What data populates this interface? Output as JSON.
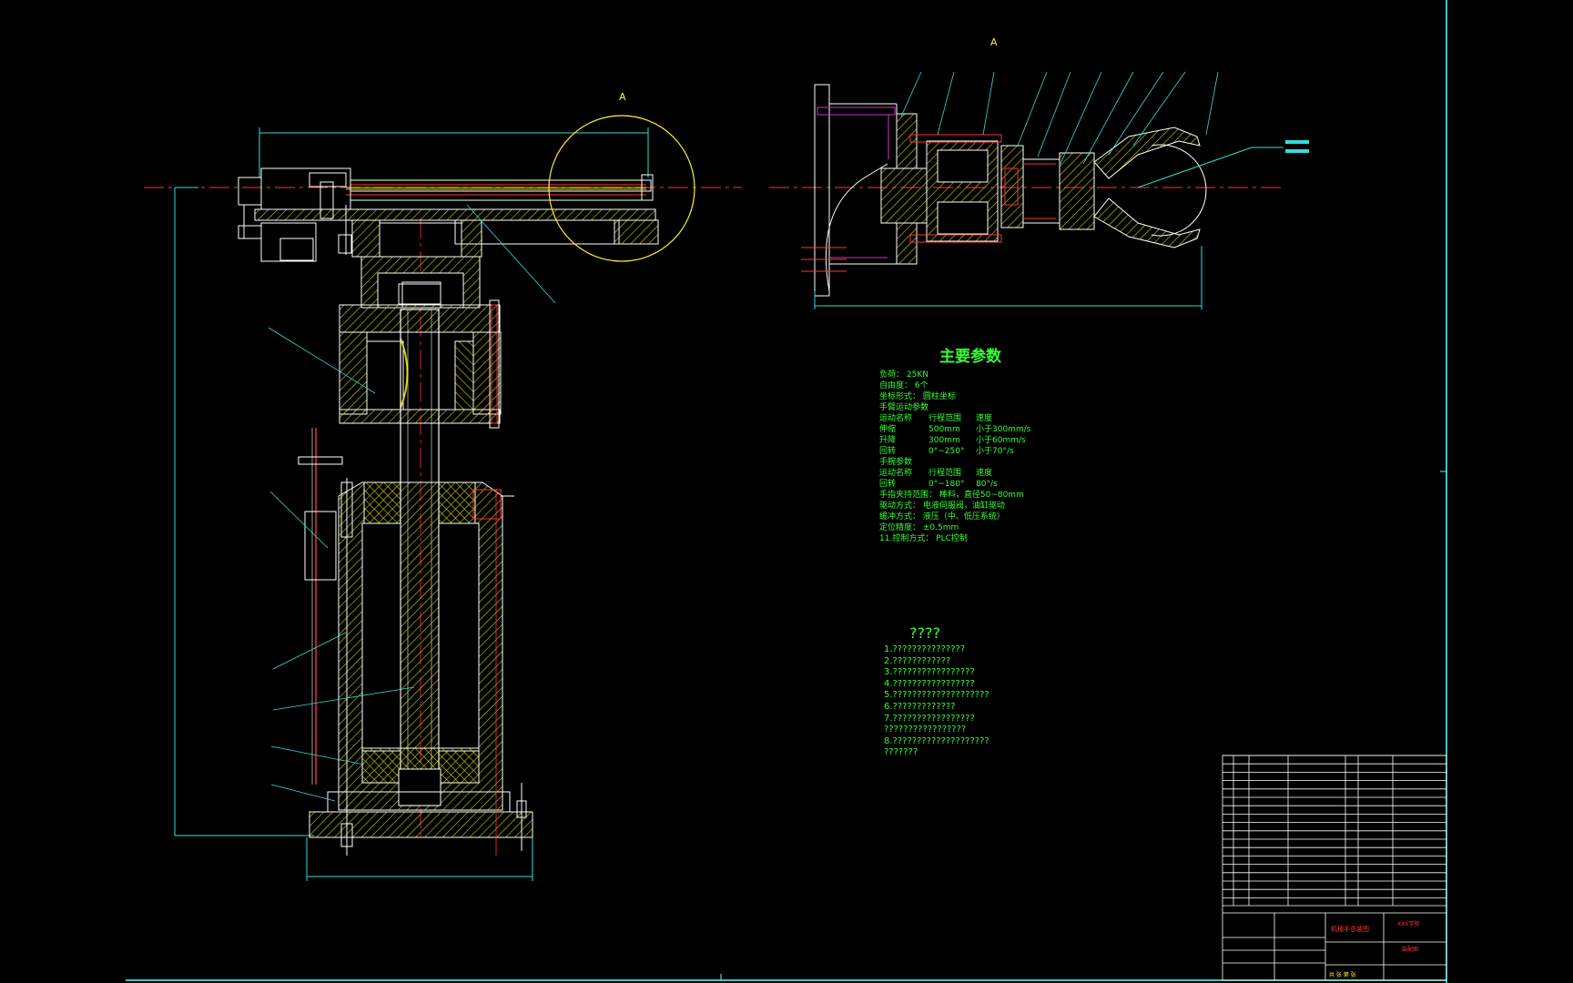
{
  "view_labels": {
    "left_A": "A",
    "right_A": "A"
  },
  "main_params": {
    "title": "主要参数",
    "rows": [
      [
        "负荷： 25KN",
        "",
        ""
      ],
      [
        "自由度： 6个",
        "",
        ""
      ],
      [
        "坐标形式： 圆柱坐标",
        "",
        ""
      ],
      [
        "手臂运动参数",
        "",
        ""
      ],
      [
        "运动名称",
        "行程范围",
        "速度"
      ],
      [
        "伸缩",
        "500mm",
        "小于300mm/s"
      ],
      [
        "升降",
        "300mm",
        "小于60mm/s"
      ],
      [
        "回转",
        "0°~250°",
        "小于70°/s"
      ],
      [
        "手腕参数",
        "",
        ""
      ],
      [
        "运动名称",
        "行程范围",
        "速度"
      ],
      [
        "回转",
        "0°~180°",
        "80°/s"
      ],
      [
        "手指夹持范围： 棒料，直径50~80mm",
        "",
        ""
      ],
      [
        "驱动方式： 电液伺服阀，油缸驱动",
        "",
        ""
      ],
      [
        "缓冲方式： 液压（中、低压系统）",
        "",
        ""
      ],
      [
        "定位精度： ±0.5mm",
        "",
        ""
      ],
      [
        "11.控制方式： PLC控制",
        "",
        ""
      ]
    ]
  },
  "notes": {
    "title": "????",
    "lines": [
      "1.???????????????",
      "2.????????????",
      "3.?????????????????",
      "4.?????????????????",
      "5.????????????????????",
      "6.?????????????",
      "7.?????????????????",
      "?????????????????",
      "8.????????????????????",
      "???????"
    ]
  },
  "title_block": {
    "drawing_name": "机械手总装图",
    "school": "XXX学院",
    "drawing_no": "装配图",
    "scale_row": "共  张  第  张"
  },
  "colors": {
    "background": "#000000",
    "frame": "#55ffff",
    "part": "#ffffff",
    "hatch": "#d4d400",
    "centerline": "#ff3333",
    "dimension": "#33dddd",
    "text": "#33ff33",
    "highlight": "#cc33cc"
  }
}
